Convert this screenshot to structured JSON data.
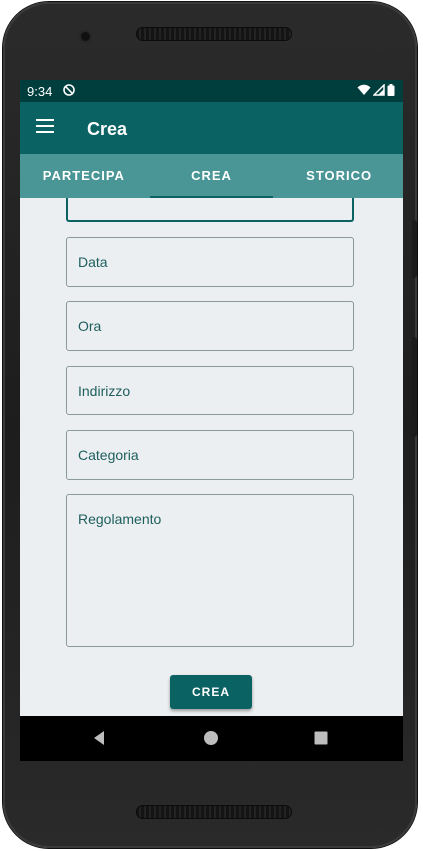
{
  "status_bar": {
    "time": "9:34",
    "icons": [
      "sync-icon",
      "wifi-icon",
      "signal-icon",
      "battery-icon"
    ]
  },
  "app_bar": {
    "title": "Crea",
    "icon": "menu-icon"
  },
  "tabs": [
    {
      "label": "PARTECIPA",
      "active": false
    },
    {
      "label": "CREA",
      "active": true
    },
    {
      "label": "STORICO",
      "active": false
    }
  ],
  "form": {
    "fields": [
      {
        "name": "partial-field",
        "placeholder": ""
      },
      {
        "name": "data",
        "placeholder": "Data"
      },
      {
        "name": "ora",
        "placeholder": "Ora"
      },
      {
        "name": "indirizzo",
        "placeholder": "Indirizzo"
      },
      {
        "name": "categoria",
        "placeholder": "Categoria"
      },
      {
        "name": "regolamento",
        "placeholder": "Regolamento"
      }
    ],
    "submit_label": "CREA"
  },
  "nav_bar": {
    "icons": [
      "back-icon",
      "home-icon",
      "recents-icon"
    ]
  },
  "colors": {
    "status_bar": "#003d3d",
    "app_bar": "#0b6263",
    "tab_bar": "#4a9696",
    "background": "#eceff1",
    "accent": "#0b6263",
    "device": "#222222"
  }
}
